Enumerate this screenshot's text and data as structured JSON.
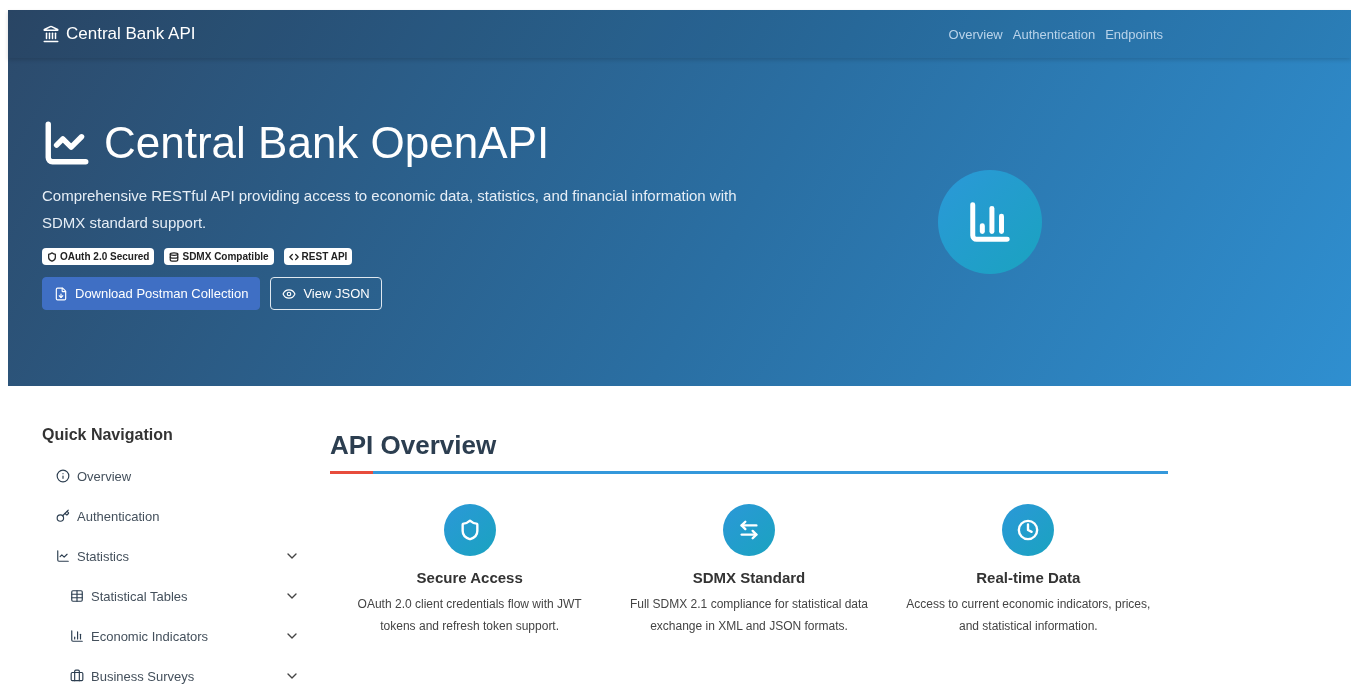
{
  "navbar": {
    "brand": "Central Bank API",
    "links": [
      "Overview",
      "Authentication",
      "Endpoints"
    ]
  },
  "hero": {
    "title": "Central Bank OpenAPI",
    "description": "Comprehensive RESTful API providing access to economic data, statistics, and financial information with SDMX standard support.",
    "badges": [
      "OAuth 2.0 Secured",
      "SDMX Compatible",
      "REST API"
    ],
    "buttons": [
      {
        "label": "Download Postman Collection",
        "kind": "primary"
      },
      {
        "label": "View JSON",
        "kind": "outline"
      }
    ]
  },
  "sidebar": {
    "title": "Quick Navigation",
    "items": [
      {
        "label": "Overview",
        "kind": "link"
      },
      {
        "label": "Authentication",
        "kind": "link"
      },
      {
        "label": "Statistics",
        "kind": "group",
        "children": [
          {
            "label": "Statistical Tables",
            "kind": "group"
          },
          {
            "label": "Economic Indicators",
            "kind": "group"
          },
          {
            "label": "Business Surveys",
            "kind": "group"
          }
        ]
      }
    ]
  },
  "section": {
    "title": "API Overview",
    "features": [
      {
        "title": "Secure Access",
        "text": "OAuth 2.0 client credentials flow with JWT tokens and refresh token support."
      },
      {
        "title": "SDMX Standard",
        "text": "Full SDMX 2.1 compliance for statistical data exchange in XML and JSON formats."
      },
      {
        "title": "Real-time Data",
        "text": "Access to current economic indicators, prices, and statistical information."
      }
    ]
  }
}
